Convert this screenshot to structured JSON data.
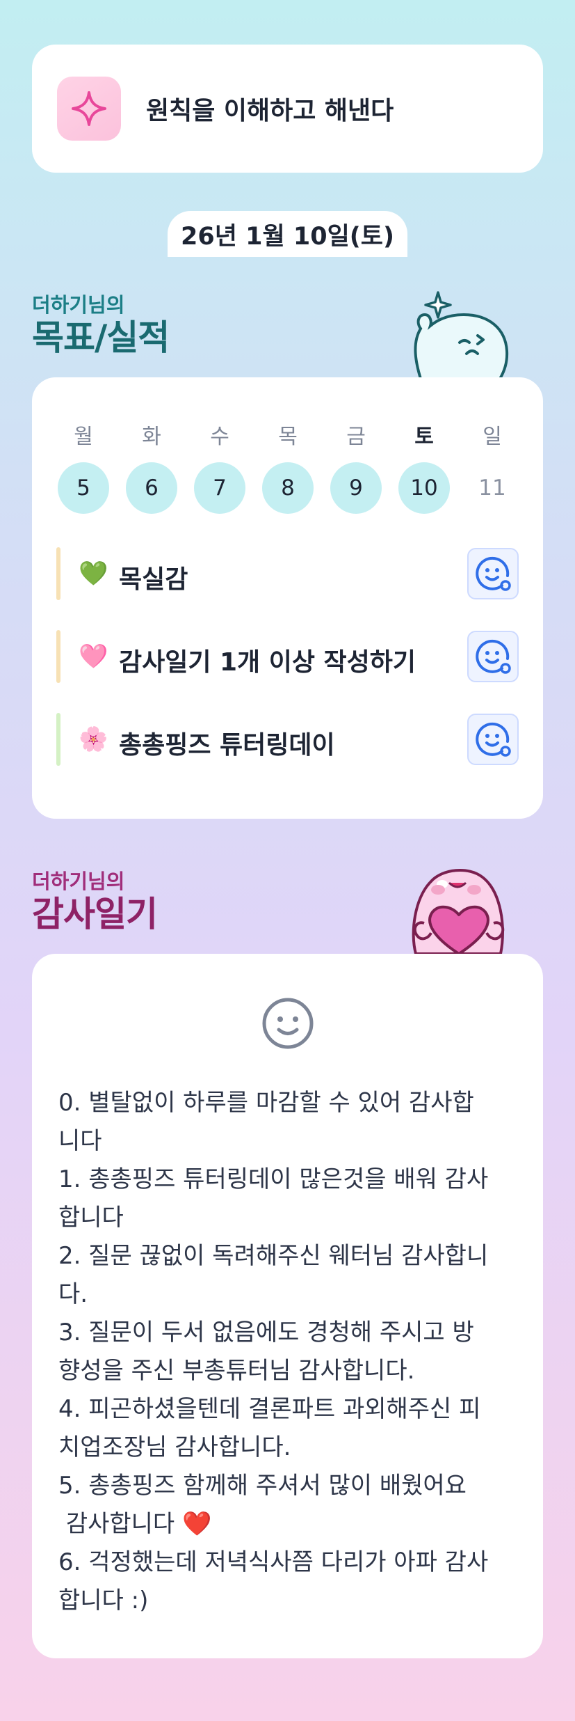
{
  "principle": {
    "icon": "sparkle-icon",
    "text": "원칙을 이해하고 해낸다"
  },
  "date": "26년 1월 10일(토)",
  "goals_section": {
    "subtitle": "더하기님의",
    "title": "목표/실적"
  },
  "week": [
    {
      "label": "월",
      "num": "5",
      "done": true
    },
    {
      "label": "화",
      "num": "6",
      "done": true
    },
    {
      "label": "수",
      "num": "7",
      "done": true
    },
    {
      "label": "목",
      "num": "8",
      "done": true
    },
    {
      "label": "금",
      "num": "9",
      "done": true
    },
    {
      "label": "토",
      "num": "10",
      "done": true,
      "today": true
    },
    {
      "label": "일",
      "num": "11",
      "done": false
    }
  ],
  "goals": [
    {
      "emoji": "💚",
      "text": "목실감",
      "bar_color": "#f7e1b4",
      "button_icon": "smiley-add-icon"
    },
    {
      "emoji": "🩷",
      "text": "감사일기 1개 이상 작성하기",
      "bar_color": "#f7e1b4",
      "button_icon": "smiley-add-icon"
    },
    {
      "emoji": "🌸",
      "text": "총총핑즈 튜터링데이",
      "bar_color": "#d4f1c4",
      "button_icon": "smiley-add-icon"
    }
  ],
  "gratitude_section": {
    "subtitle": "더하기님의",
    "title": "감사일기"
  },
  "gratitude": {
    "face_icon": "smiley-face-icon",
    "lines": [
      "0. 별탈없이 하루를 마감할 수 있어 감사합",
      "니다",
      "1. 총총핑즈 튜터링데이 많은것을 배워 감사",
      "합니다",
      "2. 질문 끊없이 독려해주신 웨터님 감사합니",
      "다.",
      "3. 질문이 두서 없음에도 경청해 주시고 방",
      "향성을 주신 부총튜터님 감사합니다.",
      "4. 피곤하셨을텐데 결론파트 과외해주신 피",
      "치업조장님 감사합니다.",
      "5. 총총핑즈 함께해 주셔서 많이 배웠어요",
      " 감사합니다 ❤️",
      "6. 걱정했는데 저녁식사쯤 다리가 아파 감사",
      "합니다 :)"
    ]
  },
  "colors": {
    "goal_title": "#1a6a70",
    "gratitude_title": "#8e2266",
    "day_filled": "#c4eff2",
    "icon_blue": "#2f6ee8"
  }
}
